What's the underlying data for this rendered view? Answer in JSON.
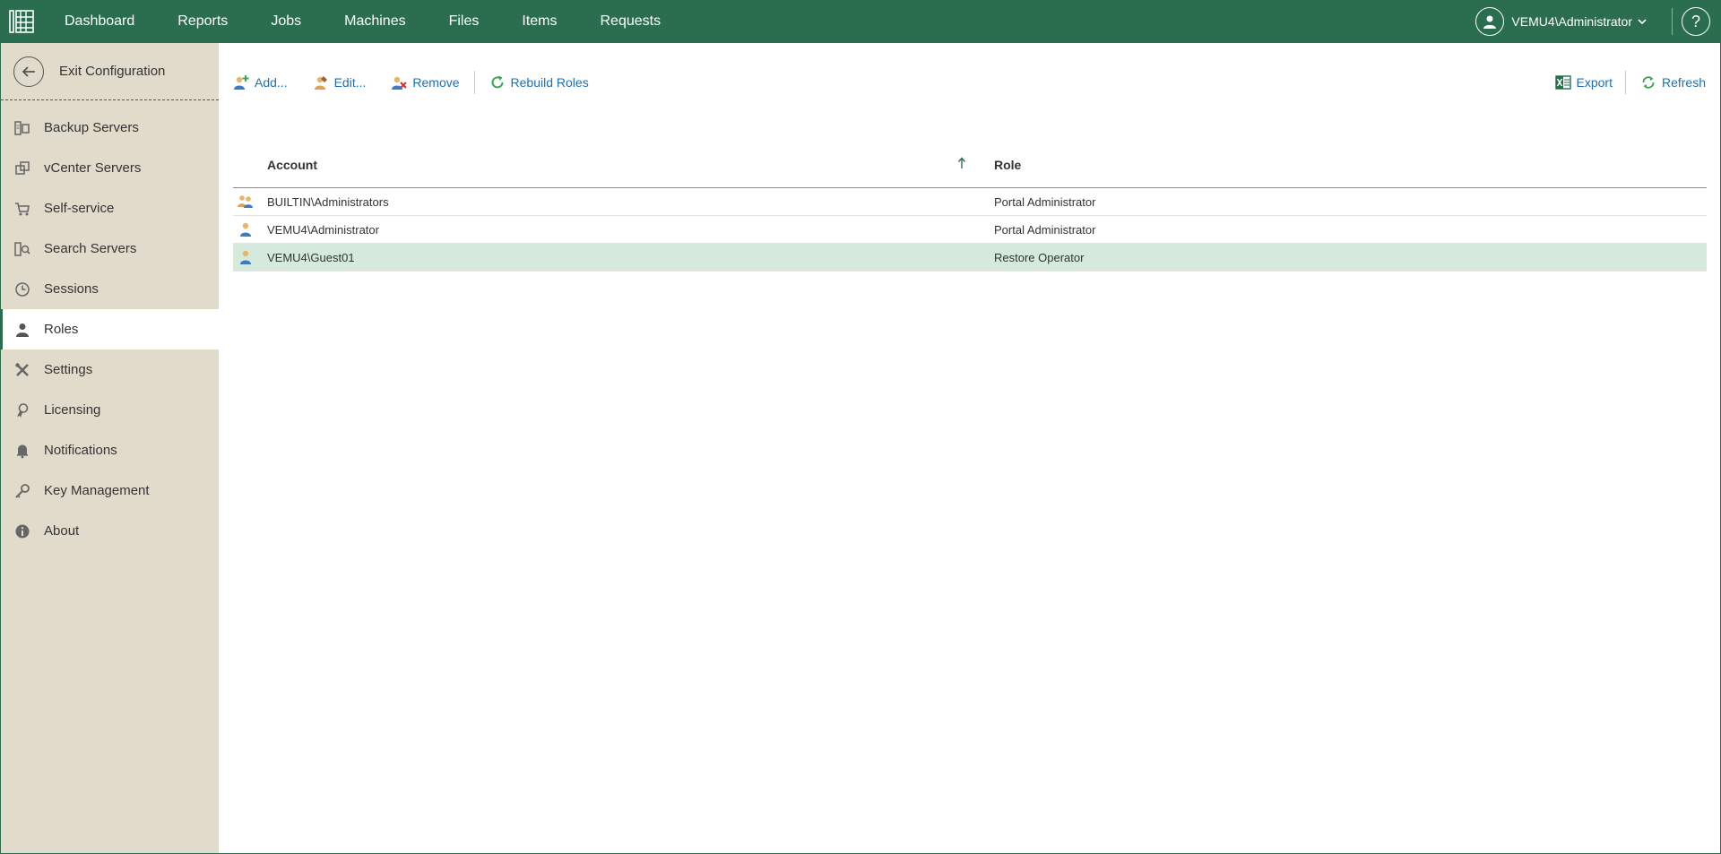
{
  "header": {
    "nav": [
      "Dashboard",
      "Reports",
      "Jobs",
      "Machines",
      "Files",
      "Items",
      "Requests"
    ],
    "user": "VEMU4\\Administrator",
    "help": "?"
  },
  "sidebar": {
    "exit_label": "Exit Configuration",
    "items": [
      {
        "label": "Backup Servers",
        "icon": "backup-servers-icon"
      },
      {
        "label": "vCenter Servers",
        "icon": "vcenter-servers-icon"
      },
      {
        "label": "Self-service",
        "icon": "cart-icon"
      },
      {
        "label": "Search Servers",
        "icon": "search-servers-icon"
      },
      {
        "label": "Sessions",
        "icon": "clock-icon"
      },
      {
        "label": "Roles",
        "icon": "person-icon",
        "active": true
      },
      {
        "label": "Settings",
        "icon": "tools-icon"
      },
      {
        "label": "Licensing",
        "icon": "license-icon"
      },
      {
        "label": "Notifications",
        "icon": "bell-icon"
      },
      {
        "label": "Key Management",
        "icon": "key-icon"
      },
      {
        "label": "About",
        "icon": "info-icon"
      }
    ]
  },
  "toolbar": {
    "add": "Add...",
    "edit": "Edit...",
    "remove": "Remove",
    "rebuild": "Rebuild Roles",
    "export": "Export",
    "refresh": "Refresh"
  },
  "table": {
    "columns": [
      "Account",
      "Role"
    ],
    "rows": [
      {
        "account": "BUILTIN\\Administrators",
        "role": "Portal Administrator",
        "icon": "group-icon"
      },
      {
        "account": "VEMU4\\Administrator",
        "role": "Portal Administrator",
        "icon": "user-icon"
      },
      {
        "account": "VEMU4\\Guest01",
        "role": "Restore Operator",
        "icon": "user-icon",
        "selected": true
      }
    ]
  },
  "colors": {
    "brand": "#2b6e4f",
    "sidebar_bg": "#e1dbcc",
    "link": "#1f6fb2",
    "selected_row": "#d5eadd"
  }
}
